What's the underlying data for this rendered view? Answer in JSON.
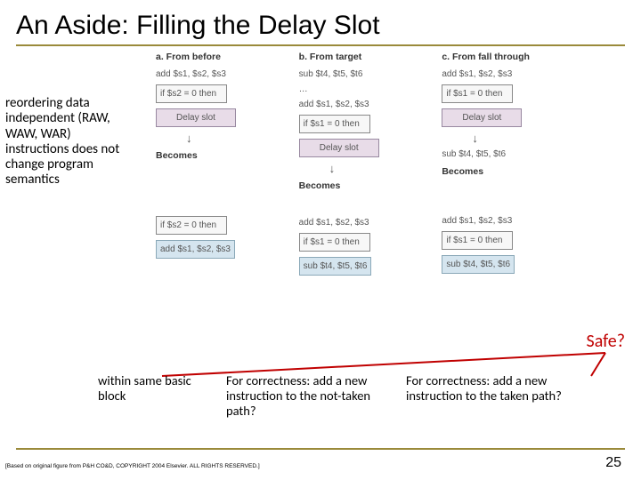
{
  "title": "An Aside: Filling the Delay Slot",
  "left_note": "reordering data independent (RAW, WAW, WAR) instructions does not change program semantics",
  "cols": {
    "a": {
      "header": "a.  From before",
      "l1": "add $s1, $s2, $s3",
      "l2": "if $s2 = 0 then",
      "slot": "Delay slot",
      "becomes": "Becomes",
      "b1": "if $s2 = 0 then",
      "b2": "add $s1, $s2, $s3"
    },
    "b": {
      "header": "b.  From target",
      "l1": "sub $t4, $t5, $t6",
      "l2": "…",
      "l3": "add $s1, $s2, $s3",
      "l4": "if $s1 = 0 then",
      "slot": "Delay slot",
      "becomes": "Becomes",
      "b1": "add $s1, $s2, $s3",
      "b2": "if $s1 = 0 then",
      "b3": "sub $t4, $t5, $t6"
    },
    "c": {
      "header": "c.  From fall through",
      "l1": "add $s1, $s2, $s3",
      "l2": "if $s1 = 0 then",
      "slot": "Delay slot",
      "l3": "sub $t4, $t5, $t6",
      "becomes": "Becomes",
      "b1": "add $s1, $s2, $s3",
      "b2": "if $s1 = 0 then",
      "b3": "sub $t4, $t5, $t6"
    }
  },
  "safe": "Safe?",
  "bottom": {
    "a": "within same basic block",
    "b": "For correctness: add a new instruction to the not-taken path?",
    "c": "For correctness: add a new instruction to the taken path?"
  },
  "citation": "[Based on original figure from P&H CO&D, COPYRIGHT 2004 Elsevier. ALL RIGHTS RESERVED.]",
  "pagenum": "25"
}
